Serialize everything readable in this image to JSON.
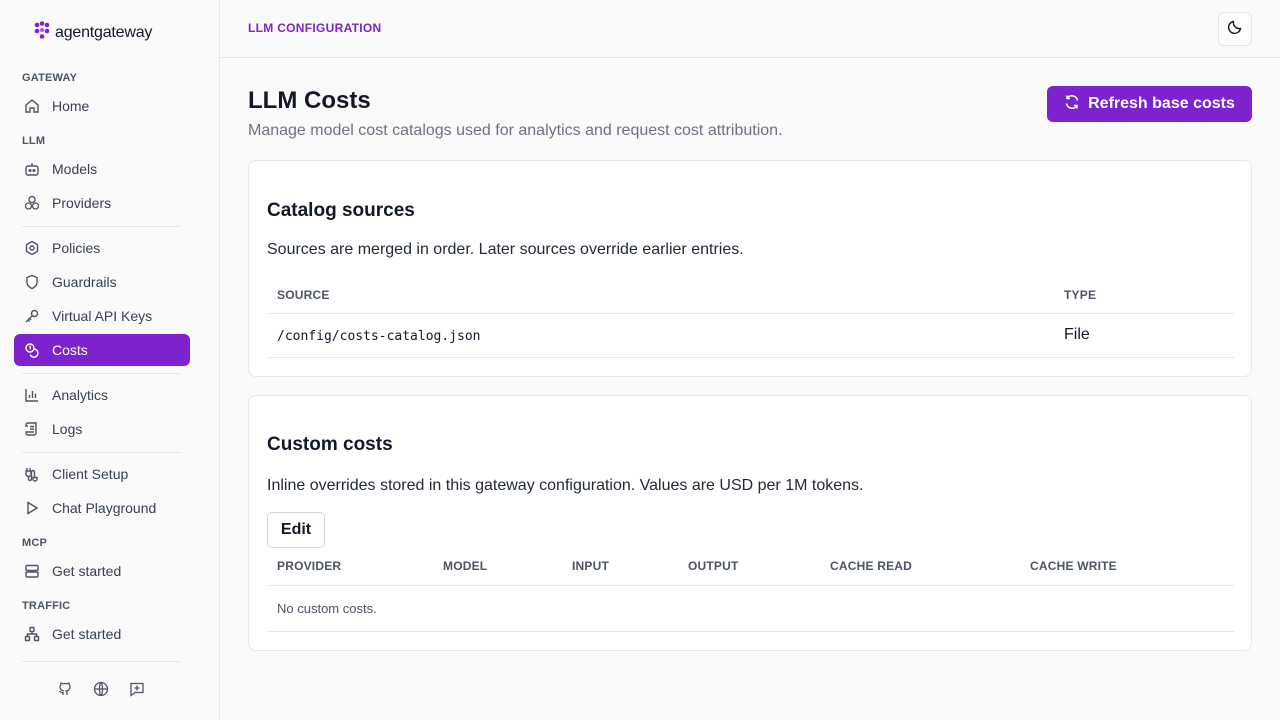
{
  "brand": {
    "name": "agentgateway"
  },
  "sidebar": {
    "sections": {
      "gateway": "GATEWAY",
      "llm": "LLM",
      "mcp": "MCP",
      "traffic": "TRAFFIC"
    },
    "items": {
      "home": "Home",
      "models": "Models",
      "providers": "Providers",
      "policies": "Policies",
      "guardrails": "Guardrails",
      "virtual_api_keys": "Virtual API Keys",
      "costs": "Costs",
      "analytics": "Analytics",
      "logs": "Logs",
      "client_setup": "Client Setup",
      "chat_playground": "Chat Playground",
      "mcp_get_started": "Get started",
      "traffic_get_started": "Get started"
    },
    "active_item": "costs"
  },
  "header": {
    "breadcrumb": "LLM CONFIGURATION"
  },
  "page": {
    "title": "LLM Costs",
    "subtitle": "Manage model cost catalogs used for analytics and request cost attribution.",
    "refresh_label": "Refresh base costs"
  },
  "catalog": {
    "title": "Catalog sources",
    "description": "Sources are merged in order. Later sources override earlier entries.",
    "columns": {
      "source": "SOURCE",
      "type": "TYPE"
    },
    "rows": [
      {
        "source": "/config/costs-catalog.json",
        "type": "File"
      }
    ]
  },
  "custom": {
    "title": "Custom costs",
    "description": "Inline overrides stored in this gateway configuration. Values are USD per 1M tokens.",
    "edit_label": "Edit",
    "columns": {
      "provider": "PROVIDER",
      "model": "MODEL",
      "input": "INPUT",
      "output": "OUTPUT",
      "cache_read": "CACHE READ",
      "cache_write": "CACHE WRITE"
    },
    "empty_text": "No custom costs."
  },
  "colors": {
    "accent": "#7e22ce"
  }
}
